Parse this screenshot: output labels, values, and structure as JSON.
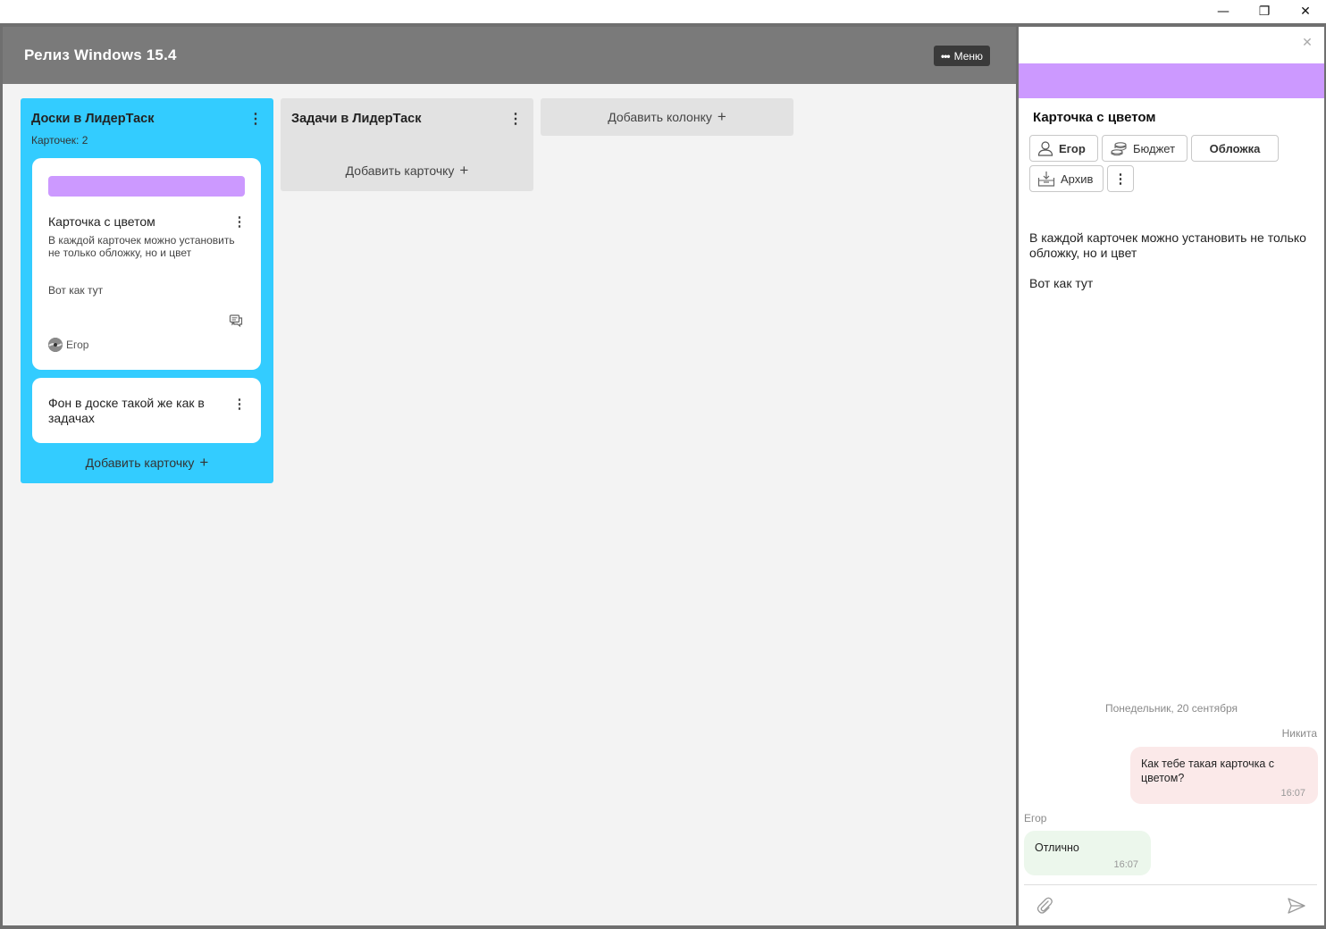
{
  "window": {
    "minimize_glyph": "—",
    "maximize_glyph": "❐",
    "close_glyph": "✕"
  },
  "board": {
    "title": "Релиз Windows 15.4",
    "menu_label": "Меню",
    "menu_dots": "•••",
    "background_color": "#f3f3f3",
    "header_color": "#7a7a7a"
  },
  "columns": [
    {
      "title": "Доски в ЛидерТаск",
      "count_label": "Карточек: 2",
      "color": "#33ccff",
      "add_card_label": "Добавить карточку",
      "cards": [
        {
          "cover_color": "#cc99ff",
          "title": "Карточка с цветом",
          "description": "В каждой карточек можно установить не только обложку, но и цвет",
          "description_extra": "Вот как тут",
          "assignee": "Егор",
          "has_comments": true
        },
        {
          "title": "Фон в доске такой же как в задачах"
        }
      ]
    },
    {
      "title": "Задачи в ЛидерТаск",
      "color": "#e2e2e2",
      "add_card_label": "Добавить карточку"
    }
  ],
  "add_column_label": "Добавить колонку",
  "plus_glyph": "+",
  "kebab_glyph": "⋮",
  "panel": {
    "close_glyph": "✕",
    "cover_color": "#cc99ff",
    "title": "Карточка с цветом",
    "buttons": {
      "user": "Егор",
      "budget": "Бюджет",
      "cover": "Обложка",
      "archive": "Архив",
      "more": "⋮"
    },
    "description": "В каждой карточек можно установить не только обложку, но и цвет",
    "description_extra": "Вот как тут",
    "chat": {
      "date": "Понедельник, 20 сентября",
      "messages": [
        {
          "author": "Никита",
          "text": "Как тебе такая карточка с цветом?",
          "time": "16:07",
          "side": "right",
          "color": "#fbe9e9"
        },
        {
          "author": "Егор",
          "text": "Отлично",
          "time": "16:07",
          "side": "left",
          "color": "#ecf7ec"
        }
      ]
    }
  }
}
